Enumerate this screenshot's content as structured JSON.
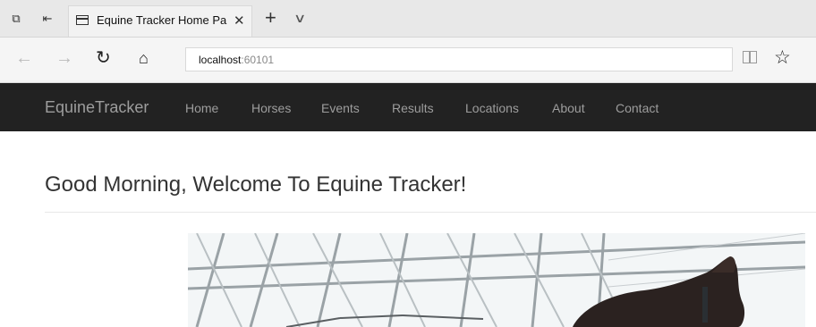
{
  "browser": {
    "tab_title": "Equine Tracker Home Pa",
    "address_host": "localhost",
    "address_port": ":60101"
  },
  "site": {
    "brand": "EquineTracker",
    "nav": [
      "Home",
      "Horses",
      "Events",
      "Results",
      "Locations",
      "About",
      "Contact"
    ]
  },
  "page": {
    "heading": "Good Morning, Welcome To Equine Tracker!"
  },
  "colors": {
    "navbar_bg": "#222222",
    "nav_text": "#9d9d9d"
  }
}
